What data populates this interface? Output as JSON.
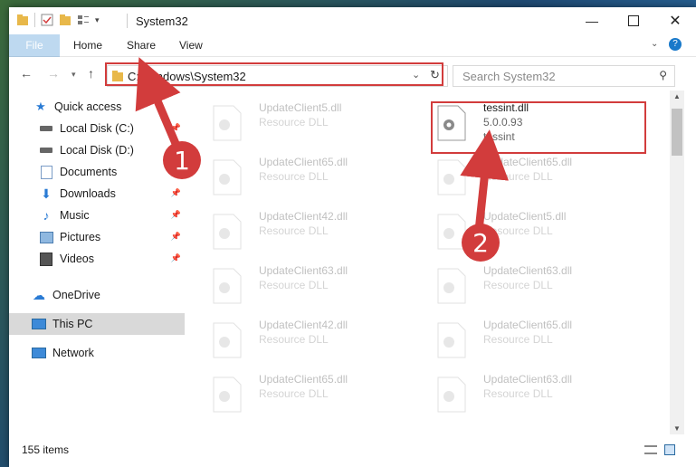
{
  "window": {
    "title": "System32"
  },
  "ribbon": {
    "tabs": [
      "File",
      "Home",
      "Share",
      "View"
    ]
  },
  "address": {
    "path": "C:\\Windows\\System32"
  },
  "search": {
    "placeholder": "Search System32"
  },
  "sidebar": {
    "items": [
      {
        "label": "Quick access",
        "icon": "star-icon"
      },
      {
        "label": "Local Disk (C:)",
        "icon": "drive-icon"
      },
      {
        "label": "Local Disk (D:)",
        "icon": "drive-icon"
      },
      {
        "label": "Documents",
        "icon": "documents-icon"
      },
      {
        "label": "Downloads",
        "icon": "download-icon"
      },
      {
        "label": "Music",
        "icon": "music-icon"
      },
      {
        "label": "Pictures",
        "icon": "pictures-icon"
      },
      {
        "label": "Videos",
        "icon": "videos-icon"
      },
      {
        "label": "OneDrive",
        "icon": "cloud-icon"
      },
      {
        "label": "This PC",
        "icon": "computer-icon"
      },
      {
        "label": "Network",
        "icon": "network-icon"
      }
    ]
  },
  "files": {
    "left": [
      {
        "name": "UpdateClient5.dll",
        "type": "Resource DLL"
      },
      {
        "name": "UpdateClient65.dll",
        "type": "Resource DLL"
      },
      {
        "name": "UpdateClient42.dll",
        "type": "Resource DLL"
      },
      {
        "name": "UpdateClient63.dll",
        "type": "Resource DLL"
      },
      {
        "name": "UpdateClient42.dll",
        "type": "Resource DLL"
      },
      {
        "name": "UpdateClient65.dll",
        "type": "Resource DLL"
      }
    ],
    "right": [
      {
        "name": "UpdateClient65.dll",
        "type": "Resource DLL"
      },
      {
        "name": "UpdateClient5.dll",
        "type": "Resource DLL"
      },
      {
        "name": "UpdateClient63.dll",
        "type": "Resource DLL"
      },
      {
        "name": "UpdateClient65.dll",
        "type": "Resource DLL"
      },
      {
        "name": "UpdateClient63.dll",
        "type": "Resource DLL"
      }
    ],
    "highlighted": {
      "name": "tessint.dll",
      "version": "5.0.0.93",
      "description": "tessint"
    }
  },
  "status": {
    "count": "155 items"
  },
  "annotations": {
    "step1": "1",
    "step2": "2",
    "color": "#d23c3c"
  }
}
